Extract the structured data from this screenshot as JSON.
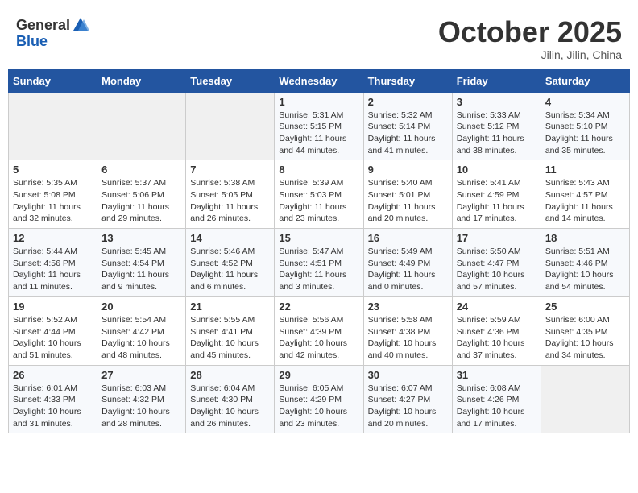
{
  "header": {
    "logo_general": "General",
    "logo_blue": "Blue",
    "month": "October 2025",
    "location": "Jilin, Jilin, China"
  },
  "days_of_week": [
    "Sunday",
    "Monday",
    "Tuesday",
    "Wednesday",
    "Thursday",
    "Friday",
    "Saturday"
  ],
  "weeks": [
    [
      {
        "day": "",
        "info": ""
      },
      {
        "day": "",
        "info": ""
      },
      {
        "day": "",
        "info": ""
      },
      {
        "day": "1",
        "info": "Sunrise: 5:31 AM\nSunset: 5:15 PM\nDaylight: 11 hours and 44 minutes."
      },
      {
        "day": "2",
        "info": "Sunrise: 5:32 AM\nSunset: 5:14 PM\nDaylight: 11 hours and 41 minutes."
      },
      {
        "day": "3",
        "info": "Sunrise: 5:33 AM\nSunset: 5:12 PM\nDaylight: 11 hours and 38 minutes."
      },
      {
        "day": "4",
        "info": "Sunrise: 5:34 AM\nSunset: 5:10 PM\nDaylight: 11 hours and 35 minutes."
      }
    ],
    [
      {
        "day": "5",
        "info": "Sunrise: 5:35 AM\nSunset: 5:08 PM\nDaylight: 11 hours and 32 minutes."
      },
      {
        "day": "6",
        "info": "Sunrise: 5:37 AM\nSunset: 5:06 PM\nDaylight: 11 hours and 29 minutes."
      },
      {
        "day": "7",
        "info": "Sunrise: 5:38 AM\nSunset: 5:05 PM\nDaylight: 11 hours and 26 minutes."
      },
      {
        "day": "8",
        "info": "Sunrise: 5:39 AM\nSunset: 5:03 PM\nDaylight: 11 hours and 23 minutes."
      },
      {
        "day": "9",
        "info": "Sunrise: 5:40 AM\nSunset: 5:01 PM\nDaylight: 11 hours and 20 minutes."
      },
      {
        "day": "10",
        "info": "Sunrise: 5:41 AM\nSunset: 4:59 PM\nDaylight: 11 hours and 17 minutes."
      },
      {
        "day": "11",
        "info": "Sunrise: 5:43 AM\nSunset: 4:57 PM\nDaylight: 11 hours and 14 minutes."
      }
    ],
    [
      {
        "day": "12",
        "info": "Sunrise: 5:44 AM\nSunset: 4:56 PM\nDaylight: 11 hours and 11 minutes."
      },
      {
        "day": "13",
        "info": "Sunrise: 5:45 AM\nSunset: 4:54 PM\nDaylight: 11 hours and 9 minutes."
      },
      {
        "day": "14",
        "info": "Sunrise: 5:46 AM\nSunset: 4:52 PM\nDaylight: 11 hours and 6 minutes."
      },
      {
        "day": "15",
        "info": "Sunrise: 5:47 AM\nSunset: 4:51 PM\nDaylight: 11 hours and 3 minutes."
      },
      {
        "day": "16",
        "info": "Sunrise: 5:49 AM\nSunset: 4:49 PM\nDaylight: 11 hours and 0 minutes."
      },
      {
        "day": "17",
        "info": "Sunrise: 5:50 AM\nSunset: 4:47 PM\nDaylight: 10 hours and 57 minutes."
      },
      {
        "day": "18",
        "info": "Sunrise: 5:51 AM\nSunset: 4:46 PM\nDaylight: 10 hours and 54 minutes."
      }
    ],
    [
      {
        "day": "19",
        "info": "Sunrise: 5:52 AM\nSunset: 4:44 PM\nDaylight: 10 hours and 51 minutes."
      },
      {
        "day": "20",
        "info": "Sunrise: 5:54 AM\nSunset: 4:42 PM\nDaylight: 10 hours and 48 minutes."
      },
      {
        "day": "21",
        "info": "Sunrise: 5:55 AM\nSunset: 4:41 PM\nDaylight: 10 hours and 45 minutes."
      },
      {
        "day": "22",
        "info": "Sunrise: 5:56 AM\nSunset: 4:39 PM\nDaylight: 10 hours and 42 minutes."
      },
      {
        "day": "23",
        "info": "Sunrise: 5:58 AM\nSunset: 4:38 PM\nDaylight: 10 hours and 40 minutes."
      },
      {
        "day": "24",
        "info": "Sunrise: 5:59 AM\nSunset: 4:36 PM\nDaylight: 10 hours and 37 minutes."
      },
      {
        "day": "25",
        "info": "Sunrise: 6:00 AM\nSunset: 4:35 PM\nDaylight: 10 hours and 34 minutes."
      }
    ],
    [
      {
        "day": "26",
        "info": "Sunrise: 6:01 AM\nSunset: 4:33 PM\nDaylight: 10 hours and 31 minutes."
      },
      {
        "day": "27",
        "info": "Sunrise: 6:03 AM\nSunset: 4:32 PM\nDaylight: 10 hours and 28 minutes."
      },
      {
        "day": "28",
        "info": "Sunrise: 6:04 AM\nSunset: 4:30 PM\nDaylight: 10 hours and 26 minutes."
      },
      {
        "day": "29",
        "info": "Sunrise: 6:05 AM\nSunset: 4:29 PM\nDaylight: 10 hours and 23 minutes."
      },
      {
        "day": "30",
        "info": "Sunrise: 6:07 AM\nSunset: 4:27 PM\nDaylight: 10 hours and 20 minutes."
      },
      {
        "day": "31",
        "info": "Sunrise: 6:08 AM\nSunset: 4:26 PM\nDaylight: 10 hours and 17 minutes."
      },
      {
        "day": "",
        "info": ""
      }
    ]
  ]
}
